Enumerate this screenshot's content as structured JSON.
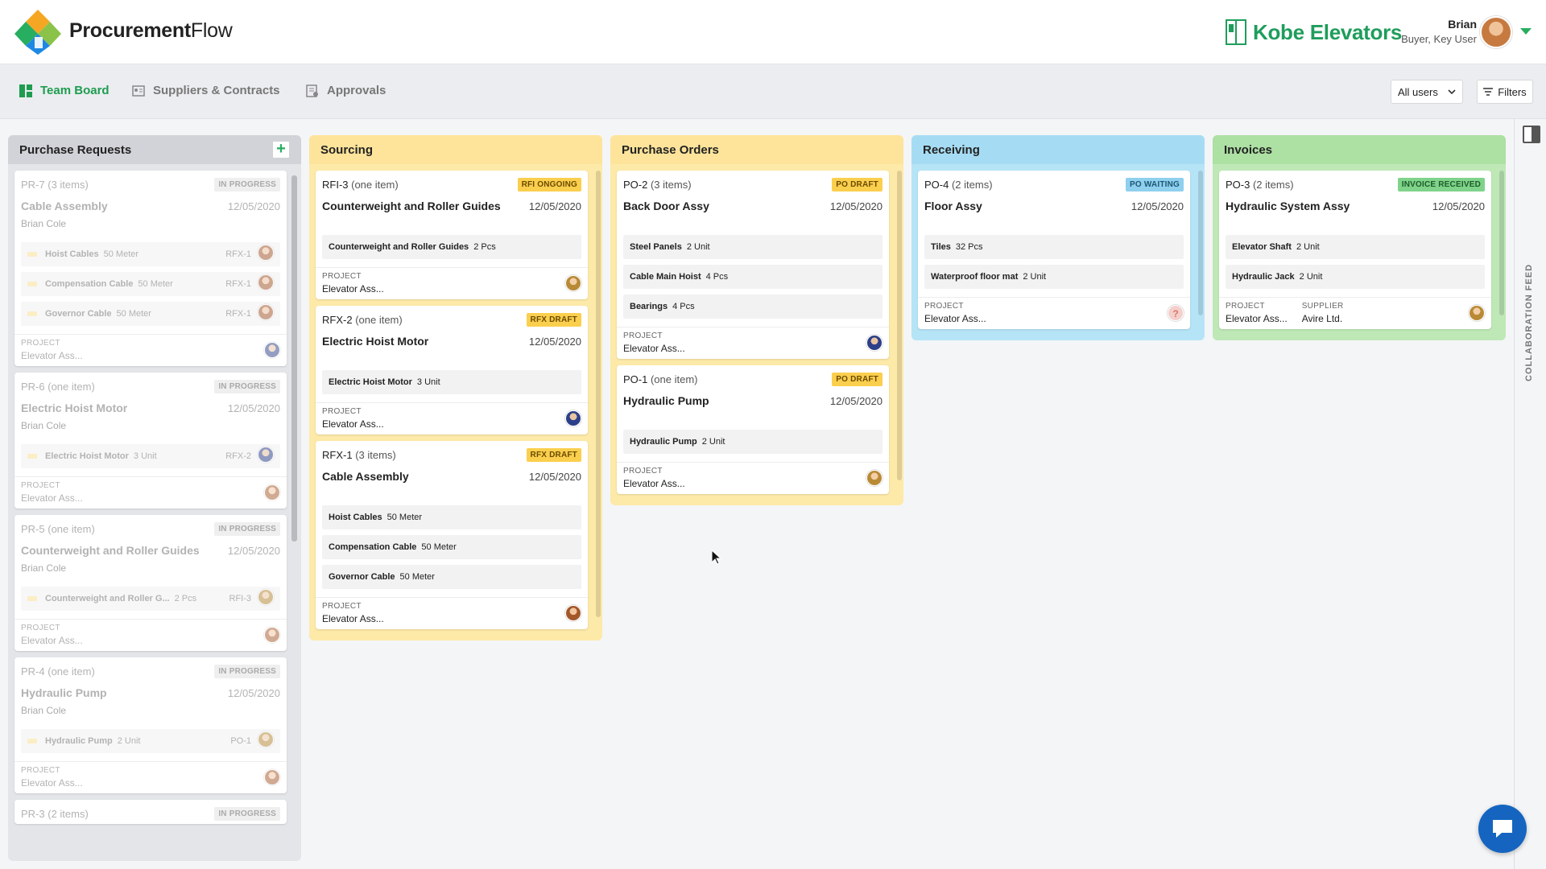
{
  "app": {
    "title_bold": "Procurement",
    "title_light": "Flow"
  },
  "brand": {
    "name": "Kobe Elevators"
  },
  "user": {
    "name": "Brian",
    "role": "Buyer, Key User"
  },
  "nav": {
    "team_board": "Team Board",
    "suppliers": "Suppliers & Contracts",
    "approvals": "Approvals",
    "user_filter": "All users",
    "filters": "Filters"
  },
  "columns": {
    "pr": "Purchase Requests",
    "sourcing": "Sourcing",
    "po": "Purchase Orders",
    "receiving": "Receiving",
    "invoices": "Invoices"
  },
  "labels": {
    "project": "PROJECT",
    "supplier": "SUPPLIER"
  },
  "pr_cards": [
    {
      "id": "PR-7",
      "count": "(3 items)",
      "status": "IN PROGRESS",
      "title": "Cable Assembly",
      "date": "12/05/2020",
      "owner": "Brian Cole",
      "project": "Elevator Ass...",
      "items": [
        {
          "name": "Hoist Cables",
          "qty": "50 Meter",
          "ref": "RFX-1"
        },
        {
          "name": "Compensation Cable",
          "qty": "50 Meter",
          "ref": "RFX-1"
        },
        {
          "name": "Governor Cable",
          "qty": "50 Meter",
          "ref": "RFX-1"
        }
      ]
    },
    {
      "id": "PR-6",
      "count": "(one item)",
      "status": "IN PROGRESS",
      "title": "Electric Hoist Motor",
      "date": "12/05/2020",
      "owner": "Brian Cole",
      "project": "Elevator Ass...",
      "items": [
        {
          "name": "Electric Hoist Motor",
          "qty": "3 Unit",
          "ref": "RFX-2"
        }
      ]
    },
    {
      "id": "PR-5",
      "count": "(one item)",
      "status": "IN PROGRESS",
      "title": "Counterweight and Roller Guides",
      "date": "12/05/2020",
      "owner": "Brian Cole",
      "project": "Elevator Ass...",
      "items": [
        {
          "name": "Counterweight and Roller G...",
          "qty": "2 Pcs",
          "ref": "RFI-3"
        }
      ]
    },
    {
      "id": "PR-4",
      "count": "(one item)",
      "status": "IN PROGRESS",
      "title": "Hydraulic Pump",
      "date": "12/05/2020",
      "owner": "Brian Cole",
      "project": "Elevator Ass...",
      "items": [
        {
          "name": "Hydraulic Pump",
          "qty": "2 Unit",
          "ref": "PO-1"
        }
      ]
    },
    {
      "id": "PR-3",
      "count": "(2 items)",
      "status": "IN PROGRESS"
    }
  ],
  "sourcing_cards": [
    {
      "id": "RFI-3",
      "count": "(one item)",
      "status": "RFI ONGOING",
      "title": "Counterweight and Roller Guides",
      "date": "12/05/2020",
      "project": "Elevator Ass...",
      "items": [
        {
          "name": "Counterweight and Roller Guides",
          "qty": "2 Pcs"
        }
      ]
    },
    {
      "id": "RFX-2",
      "count": "(one item)",
      "status": "RFX DRAFT",
      "title": "Electric Hoist Motor",
      "date": "12/05/2020",
      "project": "Elevator Ass...",
      "items": [
        {
          "name": "Electric Hoist Motor",
          "qty": "3 Unit"
        }
      ]
    },
    {
      "id": "RFX-1",
      "count": "(3 items)",
      "status": "RFX DRAFT",
      "title": "Cable Assembly",
      "date": "12/05/2020",
      "project": "Elevator Ass...",
      "items": [
        {
          "name": "Hoist Cables",
          "qty": "50 Meter"
        },
        {
          "name": "Compensation Cable",
          "qty": "50 Meter"
        },
        {
          "name": "Governor Cable",
          "qty": "50 Meter"
        }
      ]
    }
  ],
  "po_cards": [
    {
      "id": "PO-2",
      "count": "(3 items)",
      "status": "PO DRAFT",
      "title": "Back Door Assy",
      "date": "12/05/2020",
      "project": "Elevator Ass...",
      "items": [
        {
          "name": "Steel Panels",
          "qty": "2 Unit"
        },
        {
          "name": "Cable Main Hoist",
          "qty": "4 Pcs"
        },
        {
          "name": "Bearings",
          "qty": "4 Pcs"
        }
      ]
    },
    {
      "id": "PO-1",
      "count": "(one item)",
      "status": "PO DRAFT",
      "title": "Hydraulic Pump",
      "date": "12/05/2020",
      "project": "Elevator Ass...",
      "items": [
        {
          "name": "Hydraulic Pump",
          "qty": "2 Unit"
        }
      ]
    }
  ],
  "receiving_cards": [
    {
      "id": "PO-4",
      "count": "(2 items)",
      "status": "PO WAITING",
      "title": "Floor Assy",
      "date": "12/05/2020",
      "project": "Elevator Ass...",
      "items": [
        {
          "name": "Tiles",
          "qty": "32 Pcs"
        },
        {
          "name": "Waterproof floor mat",
          "qty": "2 Unit"
        }
      ]
    }
  ],
  "invoice_cards": [
    {
      "id": "PO-3",
      "count": "(2 items)",
      "status": "INVOICE RECEIVED",
      "title": "Hydraulic System Assy",
      "date": "12/05/2020",
      "project": "Elevator Ass...",
      "supplier": "Avire Ltd.",
      "items": [
        {
          "name": "Elevator Shaft",
          "qty": "2 Unit"
        },
        {
          "name": "Hydraulic Jack",
          "qty": "2 Unit"
        }
      ]
    }
  ],
  "collab": {
    "label": "COLLABORATION FEED"
  },
  "colors": {
    "accent": "#1e9c4f",
    "brand": "#1f9d5c",
    "chat": "#1565c0"
  }
}
